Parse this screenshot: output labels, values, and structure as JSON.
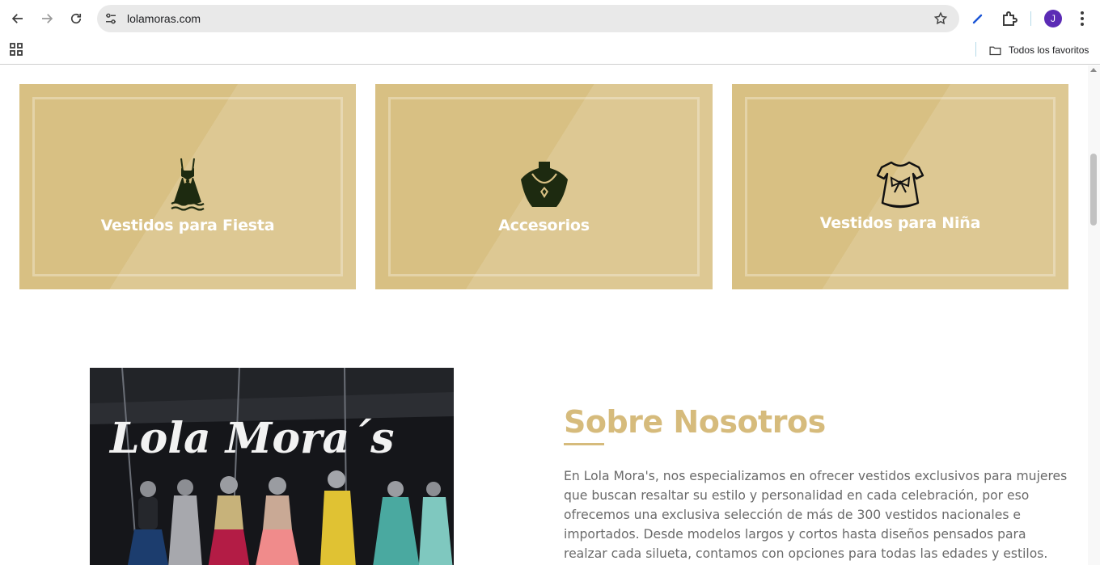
{
  "browser": {
    "url": "lolamoras.com",
    "profile_initial": "J",
    "bookmark_folder_label": "Todos los favoritos",
    "colors": {
      "avatar": "#5b2bb5",
      "omnibox": "#e9e9e9"
    }
  },
  "categories": [
    {
      "title": "Vestidos para Fiesta",
      "icon": "party-dress-icon"
    },
    {
      "title": "Accesorios",
      "icon": "necklace-bust-icon"
    },
    {
      "title": "Vestidos para Niña",
      "icon": "girl-dress-icon"
    }
  ],
  "photo": {
    "sign_text": "Lola Mora´s"
  },
  "about": {
    "title": "Sobre Nosotros",
    "paragraph": "En Lola Mora's, nos especializamos en ofrecer vestidos exclusivos para mujeres que buscan resaltar su estilo y personalidad en cada celebración, por eso ofrecemos una exclusiva selección de más de 300 vestidos nacionales e importados. Desde modelos largos y cortos hasta diseños pensados para realzar cada silueta, contamos con opciones para todas las edades y estilos. Nuestro compromiso es"
  },
  "colors": {
    "card": "#d8c083",
    "accent": "#d6bb7c",
    "text": "#6a6a6a"
  }
}
